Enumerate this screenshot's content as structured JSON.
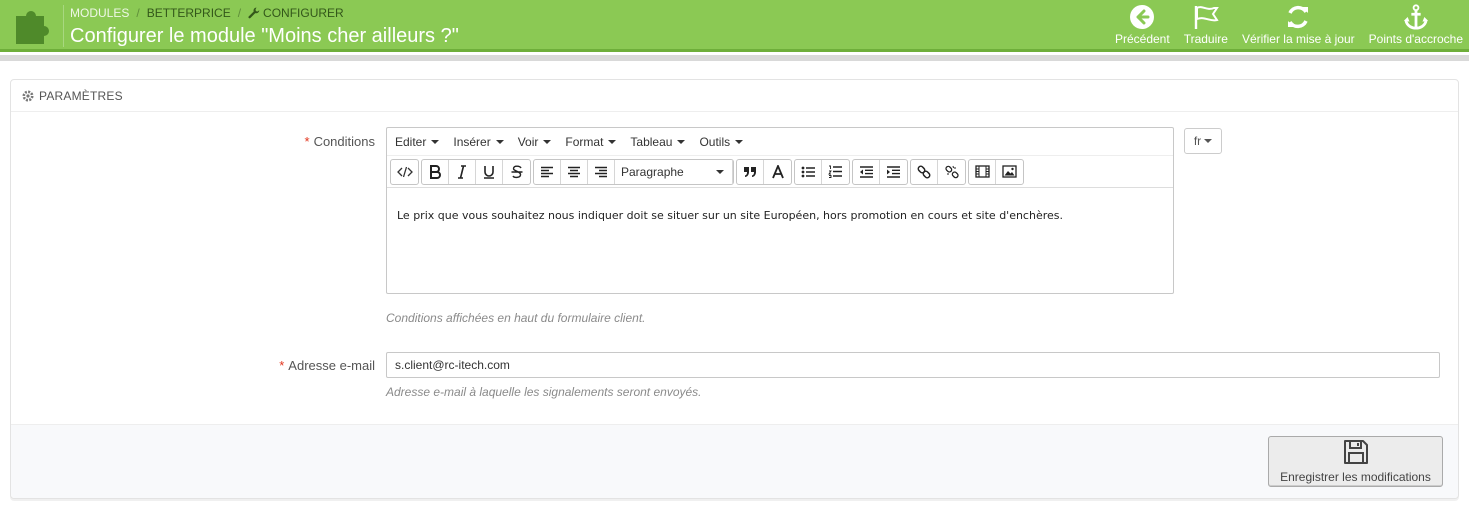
{
  "header": {
    "breadcrumb": [
      "MODULES",
      "BETTERPRICE",
      "CONFIGURER"
    ],
    "breadcrumb_sep": "/",
    "title": "Configurer le module \"Moins cher ailleurs ?\"",
    "toolbar": [
      {
        "icon": "arrow-left-circle-icon",
        "label": "Précédent"
      },
      {
        "icon": "flag-icon",
        "label": "Traduire"
      },
      {
        "icon": "refresh-icon",
        "label": "Vérifier la mise à jour"
      },
      {
        "icon": "anchor-icon",
        "label": "Points d'accroche"
      }
    ],
    "colors": {
      "bar": "#8bc954",
      "accent_dark": "#33571a"
    }
  },
  "panel": {
    "heading": "PARAMÈTRES",
    "conditions": {
      "label": "Conditions",
      "required_mark": "*",
      "menus": [
        "Editer",
        "Insérer",
        "Voir",
        "Format",
        "Tableau",
        "Outils"
      ],
      "format_select": "Paragraphe",
      "content": "Le prix que vous souhaitez nous indiquer doit se situer sur un site Européen, hors promotion en cours et site d'enchères.",
      "help": "Conditions affichées en haut du formulaire client.",
      "lang": "fr"
    },
    "email": {
      "label": "Adresse e-mail",
      "required_mark": "*",
      "value": "s.client@rc-itech.com",
      "help": "Adresse e-mail à laquelle les signalements seront envoyés."
    },
    "save_label": "Enregistrer les modifications"
  }
}
